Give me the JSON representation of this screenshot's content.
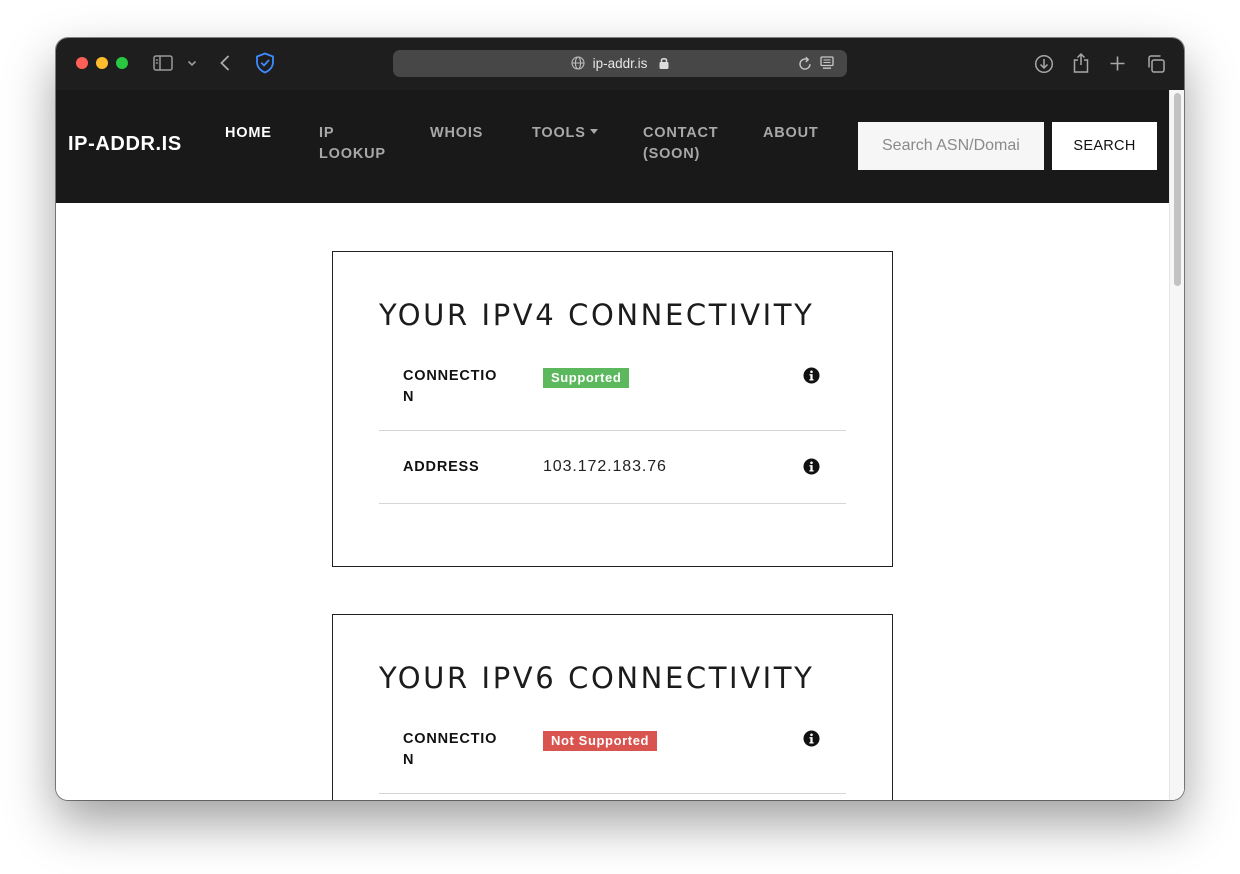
{
  "browser": {
    "url": "ip-addr.is"
  },
  "nav": {
    "brand": "IP-ADDR.IS",
    "links": [
      {
        "label": "HOME"
      },
      {
        "label": "IP",
        "label2": "LOOKUP"
      },
      {
        "label": "WHOIS"
      },
      {
        "label": "TOOLS"
      },
      {
        "label": "CONTACT",
        "label2": "(SOON)"
      },
      {
        "label": "ABOUT"
      }
    ],
    "search_placeholder": "Search ASN/Domain",
    "search_button": "SEARCH"
  },
  "ipv4": {
    "title": "YOUR IPV4 CONNECTIVITY",
    "connection_label_1": "CONNECTIO",
    "connection_label_2": "N",
    "connection_status": "Supported",
    "address_label": "ADDRESS",
    "address_value": "103.172.183.76"
  },
  "ipv6": {
    "title": "YOUR IPV6 CONNECTIVITY",
    "connection_label_1": "CONNECTIO",
    "connection_label_2": "N",
    "connection_status": "Not Supported"
  },
  "colors": {
    "navbar_bg": "#191919",
    "supported": "#5cb85c",
    "not_supported": "#d9534f"
  }
}
